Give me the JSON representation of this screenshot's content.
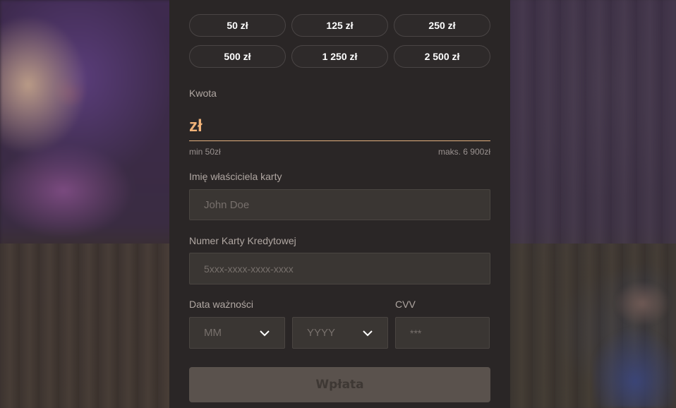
{
  "quick_amounts": [
    "50 zł",
    "125 zł",
    "250 zł",
    "500 zł",
    "1 250 zł",
    "2 500 zł"
  ],
  "amount": {
    "label": "Kwota",
    "currency": "zł",
    "value": "",
    "min_hint": "min 50zł",
    "max_hint": "maks. 6 900zł"
  },
  "cardholder": {
    "label": "Imię właściciela karty",
    "placeholder": "John Doe"
  },
  "card_number": {
    "label": "Numer Karty Kredytowej",
    "placeholder": "5xxx-xxxx-xxxx-xxxx"
  },
  "expiry": {
    "label": "Data ważności",
    "month_placeholder": "MM",
    "year_placeholder": "YYYY"
  },
  "cvv": {
    "label": "CVV",
    "placeholder": "***"
  },
  "submit_label": "Wpłata",
  "colors": {
    "accent": "#f0b278",
    "panel": "#2a2626",
    "input_bg": "#3a3633",
    "button_disabled": "#5a524d"
  }
}
